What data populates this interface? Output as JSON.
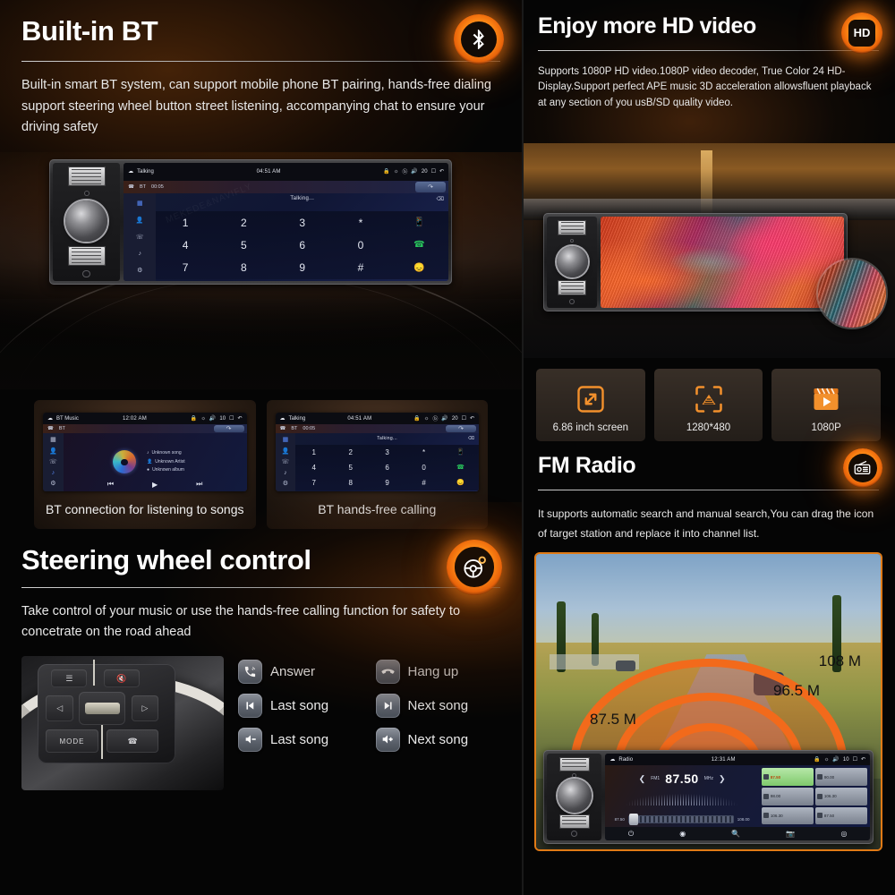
{
  "left_panel": {
    "bt_section": {
      "title": "Built-in BT",
      "badge_icon": "bluetooth-icon",
      "description": "Built-in smart BT system, can support mobile phone BT pairing, hands-free dialing support steering wheel button street listening, accompanying chat to ensure your driving safety"
    },
    "main_unit_screen": {
      "status_bar": {
        "app_label": "Talking",
        "time": "04:51 AM",
        "volume": "20",
        "icons": [
          "cloud-icon",
          "lock-icon",
          "brightness-icon",
          "bluetooth-icon",
          "volume-icon",
          "card-icon",
          "back-icon"
        ]
      },
      "call_bar": {
        "source": "BT",
        "duration": "00:05",
        "back_icon": "return-icon"
      },
      "talking_label": "Talking...",
      "delete_icon": "backspace-icon",
      "sidebar_icons": [
        "dialpad-icon",
        "contacts-icon",
        "call-history-icon",
        "music-icon",
        "settings-icon"
      ],
      "keypad": [
        [
          "1",
          "2",
          "3",
          "*",
          "phone-icon"
        ],
        [
          "4",
          "5",
          "6",
          "0",
          "call-icon"
        ],
        [
          "7",
          "8",
          "9",
          "#",
          "hangup-icon"
        ]
      ]
    },
    "cards": [
      {
        "caption": "BT connection for listening to songs",
        "screen": {
          "app_label": "BT Music",
          "time": "12:02 AM",
          "volume": "10",
          "source": "BT",
          "track_title": "Unknown song",
          "track_artist": "Unknown Artist",
          "track_album": "Unknown album"
        }
      },
      {
        "caption": "BT hands-free calling",
        "screen": {
          "app_label": "Talking",
          "time": "04:51 AM",
          "volume": "20",
          "source": "BT",
          "duration": "00:05",
          "talking_label": "Talking..."
        }
      }
    ],
    "steering_section": {
      "title": "Steering wheel control",
      "badge_icon": "steering-wheel-icon",
      "description": "Take control of your music or use the hands-free calling function for safety to concetrate on the road ahead",
      "wheel_photo": {
        "mode_label": "MODE",
        "buttons": [
          "mute-icon",
          "seek-left-icon",
          "seek-right-icon",
          "up-icon",
          "down-icon",
          "phone-icon",
          "source-icon"
        ]
      },
      "controls": [
        {
          "label": "Answer",
          "icon": "answer-call-icon"
        },
        {
          "label": "Hang up",
          "icon": "hangup-call-icon"
        },
        {
          "label": "Last song",
          "icon": "previous-track-icon"
        },
        {
          "label": "Next song",
          "icon": "next-track-icon"
        },
        {
          "label": "Last song",
          "icon": "volume-down-icon"
        },
        {
          "label": "Next song",
          "icon": "volume-up-icon"
        }
      ]
    }
  },
  "right_panel": {
    "hd_section": {
      "title": "Enjoy more HD video",
      "badge_icon": "hd-icon",
      "badge_text": "HD",
      "description": "Supports 1080P HD video.1080P video decoder, True Color 24 HD-Display.Support perfect APE music 3D acceleration allowsfluent playback at any section of you usB/SD quality video."
    },
    "specs": [
      {
        "label": "6.86 inch screen",
        "icon": "expand-arrows-icon"
      },
      {
        "label": "1280*480",
        "icon": "resolution-icon"
      },
      {
        "label": "1080P",
        "icon": "video-clapper-icon"
      }
    ],
    "fm_section": {
      "title": "FM Radio",
      "badge_icon": "radio-icon",
      "description": "It supports automatic search and manual search,You can drag the icon of target station and replace it into channel list.",
      "wave_labels": [
        "108 M",
        "96.5 M",
        "87.5 M"
      ],
      "radio_screen": {
        "status_bar": {
          "app_label": "Radio",
          "time": "12:31 AM",
          "volume": "10"
        },
        "band": "FM1",
        "frequency": "87.50",
        "unit": "MHz",
        "slider_min": "87.50",
        "slider_max": "108.00",
        "presets": [
          "87.50",
          "90.00",
          "98.00",
          "106.30",
          "106.30",
          "87.50"
        ],
        "active_preset_index": 0,
        "nav_icons": [
          "power-icon",
          "stereo-toggle-icon",
          "search-icon",
          "scan-icon",
          "band-icon"
        ]
      }
    }
  },
  "colors": {
    "accent": "#f2711c",
    "accent_glow": "#ff8a16",
    "background": "#000000",
    "text": "#ffffff"
  },
  "watermark": "MEKEDE&NAVIFLY"
}
